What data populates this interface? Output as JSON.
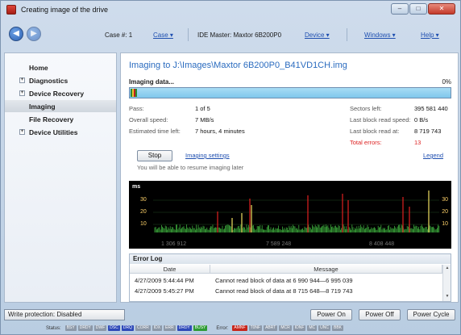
{
  "window": {
    "title": "Creating image of the drive",
    "controls": [
      "–",
      "□",
      "✕"
    ]
  },
  "toolbar": {
    "case_label": "Case #: 1",
    "case_menu": "Case ▾",
    "ide_master": "IDE Master: Maxtor 6B200P0",
    "device_menu": "Device ▾",
    "windows_menu": "Windows ▾",
    "help_menu": "Help ▾"
  },
  "sidebar": {
    "items": [
      {
        "label": "Home",
        "expandable": false,
        "active": false
      },
      {
        "label": "Diagnostics",
        "expandable": true,
        "active": false
      },
      {
        "label": "Device Recovery",
        "expandable": true,
        "active": false
      },
      {
        "label": "Imaging",
        "expandable": false,
        "active": true
      },
      {
        "label": "File Recovery",
        "expandable": false,
        "active": false
      },
      {
        "label": "Device Utilities",
        "expandable": true,
        "active": false
      }
    ]
  },
  "main": {
    "heading": "Imaging to J:\\Images\\Maxtor 6B200P0_B41VD1CH.img",
    "progress_label": "Imaging data...",
    "progress_percent": "0%",
    "progress_value": 0,
    "stats_left": [
      {
        "label": "Pass:",
        "value": "1 of 5"
      },
      {
        "label": "Overall speed:",
        "value": "7 MB/s"
      },
      {
        "label": "Estimated time left:",
        "value": "7 hours, 4 minutes"
      }
    ],
    "stats_right": [
      {
        "label": "Sectors left:",
        "value": "395 581 440",
        "highlight": false
      },
      {
        "label": "Last block read speed:",
        "value": "0 B/s",
        "highlight": false
      },
      {
        "label": "Last block read at:",
        "value": "8 719 743",
        "highlight": false
      },
      {
        "label": "Total errors:",
        "value": "13",
        "highlight": true
      }
    ],
    "stop_button": "Stop",
    "settings_link": "Imaging settings",
    "legend_link": "Legend",
    "resume_note": "You will be able to resume imaging later"
  },
  "graph": {
    "unit": "ms",
    "y_ticks": [
      "30",
      "20",
      "10"
    ],
    "x_ticks": [
      "1 306 912",
      "7 589 248",
      "8 408 448"
    ],
    "colors": {
      "normal": "#3cab3c",
      "error": "#e02020",
      "warn": "#f0e060",
      "grid": "#1f4a1f"
    }
  },
  "error_log": {
    "title": "Error Log",
    "columns": [
      "Date",
      "Message"
    ],
    "rows": [
      {
        "date": "4/27/2009 5:44:44 PM",
        "message": "Cannot read block of data at 6 990 944—6 995 039"
      },
      {
        "date": "4/27/2009 5:45:27 PM",
        "message": "Cannot read block of data at 8 715 648—8 719 743"
      }
    ]
  },
  "bottom": {
    "write_protection": "Write protection: Disabled",
    "power_on": "Power On",
    "power_off": "Power Off",
    "power_cycle": "Power Cycle",
    "status_label": "Status:",
    "status_indicators": [
      {
        "text": "BSY",
        "state": "off"
      },
      {
        "text": "DRDY",
        "state": "off"
      },
      {
        "text": "DWF",
        "state": "off"
      },
      {
        "text": "DSC",
        "state": "blue"
      },
      {
        "text": "DRQ",
        "state": "blue"
      },
      {
        "text": "CORR",
        "state": "off"
      },
      {
        "text": "IDX",
        "state": "off"
      },
      {
        "text": "ERR",
        "state": "off"
      },
      {
        "text": "DRDY",
        "state": "blue"
      },
      {
        "text": "BUSY",
        "state": "green"
      }
    ],
    "error_label": "Error:",
    "error_indicators": [
      {
        "text": "AMNF",
        "state": "red"
      },
      {
        "text": "T0NF",
        "state": "off"
      },
      {
        "text": "ABRT",
        "state": "off"
      },
      {
        "text": "MCR",
        "state": "off"
      },
      {
        "text": "IDNF",
        "state": "off"
      },
      {
        "text": "MC",
        "state": "off"
      },
      {
        "text": "UNC",
        "state": "off"
      },
      {
        "text": "BBK",
        "state": "off"
      }
    ]
  }
}
